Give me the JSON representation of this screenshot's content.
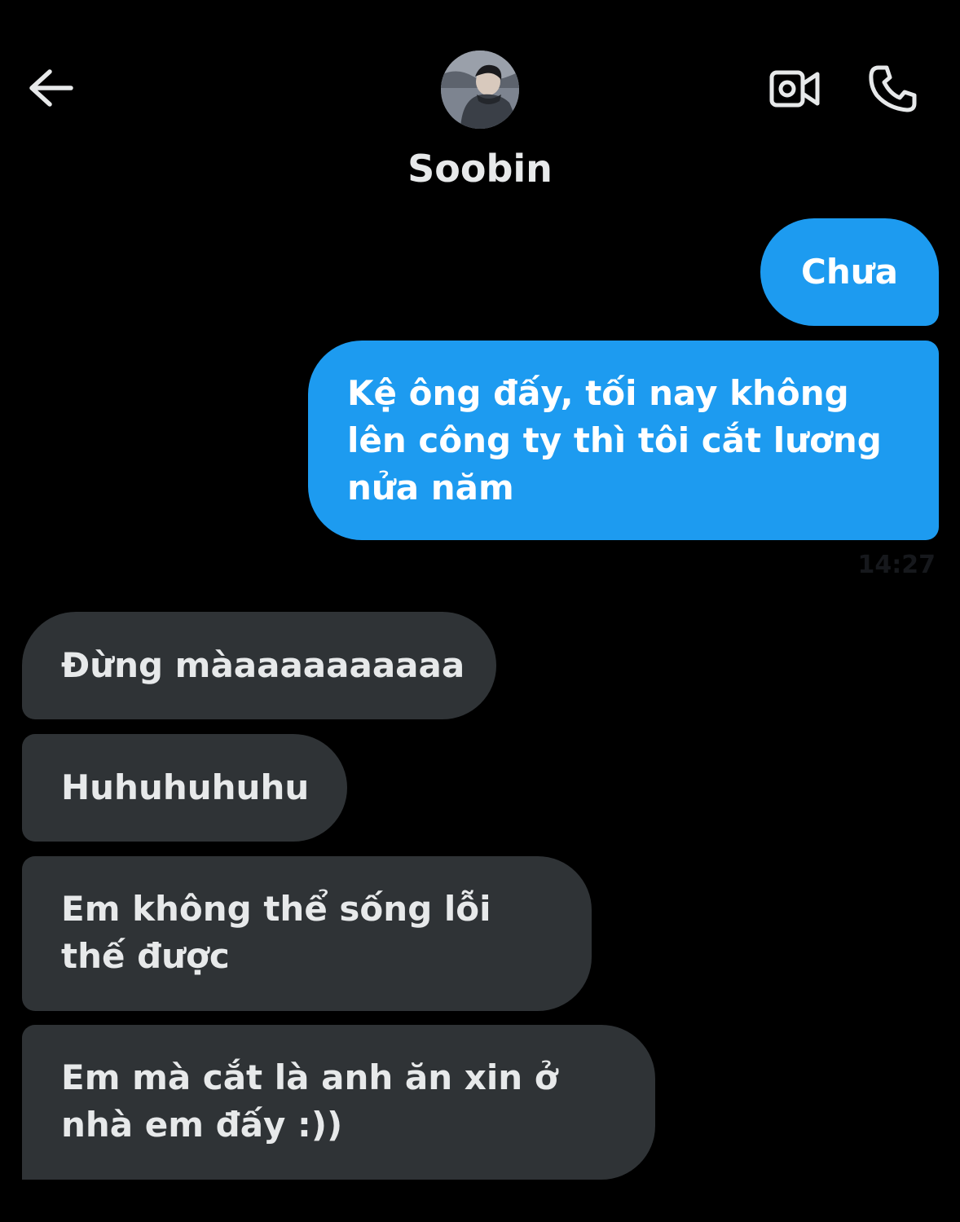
{
  "header": {
    "back_icon": "arrow-left-icon",
    "contact_name": "Soobin",
    "video_icon": "video-camera-icon",
    "call_icon": "phone-icon"
  },
  "colors": {
    "background": "#000000",
    "sent_bubble": "#1d9bf0",
    "received_bubble": "#2f3336",
    "text_primary": "#e7e9ea"
  },
  "messages": [
    {
      "direction": "sent",
      "text": "Chưa"
    },
    {
      "direction": "sent",
      "text": "Kệ ông đấy, tối nay không lên công ty thì tôi cắt lương nửa năm"
    },
    {
      "direction": "received",
      "text": "Đừng màaaaaaaaaaa"
    },
    {
      "direction": "received",
      "text": "Huhuhuhuhu"
    },
    {
      "direction": "received",
      "text": "Em không thể sống lỗi thế được"
    },
    {
      "direction": "received",
      "text": "Em mà cắt là anh ăn xin ở nhà em đấy :))"
    }
  ],
  "timestamp": "14:27"
}
